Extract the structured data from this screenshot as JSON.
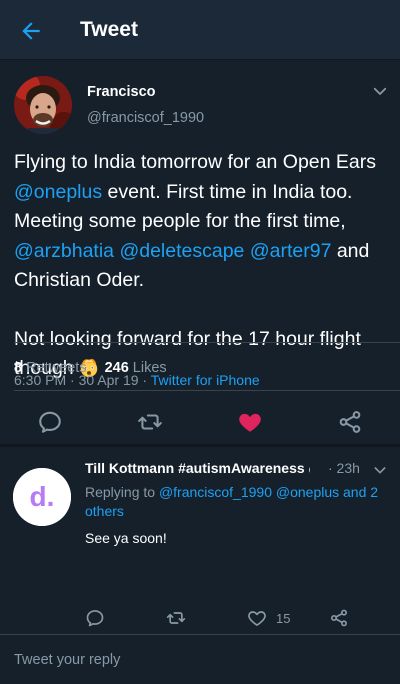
{
  "header": {
    "title": "Tweet",
    "back_icon": "back-arrow-icon"
  },
  "tweet": {
    "author_name": "Francisco",
    "author_handle": "@franciscof_1990",
    "text_parts": {
      "p1a": "Flying to India tomorrow for an Open Ears ",
      "m1": "@oneplus",
      "p1b": " event. First time in India too. Meeting some people for the first time, ",
      "m2": "@arzbhatia",
      "s1": " ",
      "m3": "@deletescape",
      "s2": " ",
      "m4": "@arter97",
      "p1c": " and Christian Oder.",
      "p2": "Not looking forward for the 17 hour flight though"
    },
    "emoji": "exploding-head-emoji",
    "time": "6:30 PM · 30 Apr 19 · ",
    "client": "Twitter for iPhone",
    "retweets_count": "8",
    "retweets_label": "Retweets",
    "likes_count": "246",
    "likes_label": "Likes",
    "liked": true
  },
  "actions": {
    "icons": [
      "reply-icon",
      "retweet-icon",
      "like-icon",
      "share-icon"
    ]
  },
  "reply": {
    "author_name": "Till Kottmann #autismAwareness @...",
    "time": "· 23h",
    "replying_prefix": "Replying to ",
    "replying_handles": "@franciscof_1990 @oneplus and 2 others",
    "text": "See ya soon!",
    "likes": "15",
    "avatar_letter": "d."
  },
  "compose": {
    "placeholder": "Tweet your reply"
  },
  "colors": {
    "background": "#15202b",
    "header": "#1c2938",
    "accent": "#1da1f2",
    "like": "#e0245e",
    "secondary_text": "#8899a6",
    "avatar_purple": "#b57cf5"
  }
}
